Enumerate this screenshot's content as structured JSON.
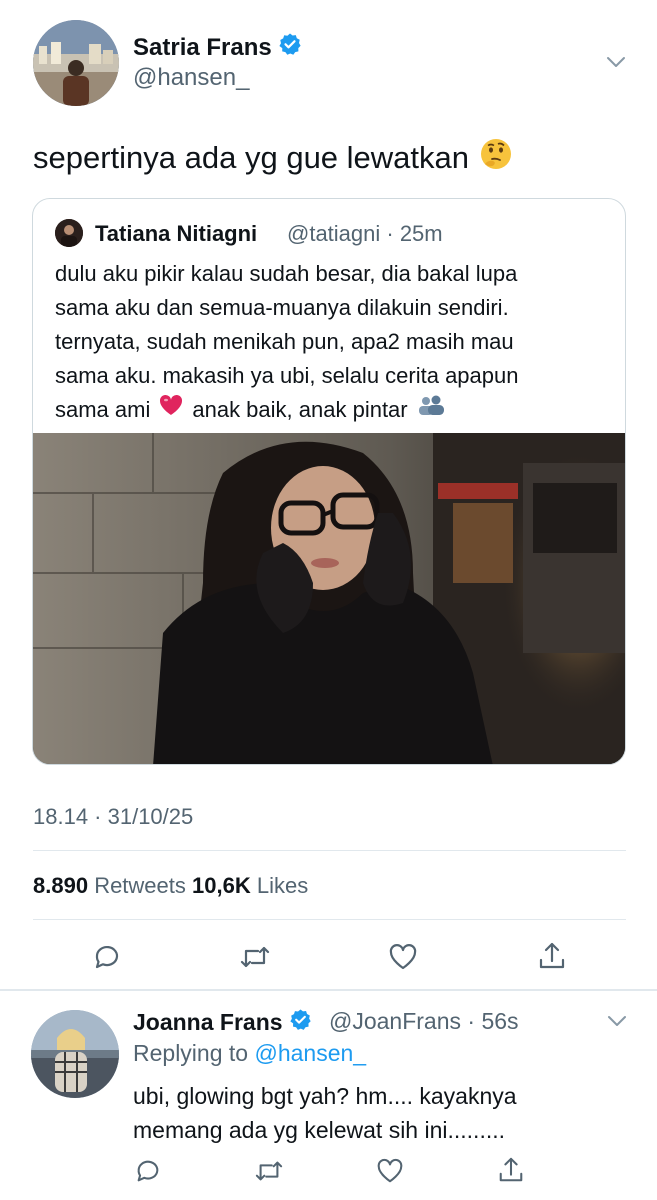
{
  "tweet": {
    "author_name": "Satria Frans",
    "author_handle": "@hansen_",
    "text": "sepertinya ada yg gue lewatkan",
    "emoji": "🤔",
    "verified": true,
    "quoted": {
      "author_name": "Tatiana Nitiagni",
      "meta": "@tatiagni · 25m",
      "lines": [
        "dulu aku pikir kalau sudah besar, dia bakal lupa",
        "sama aku dan semua-muanya dilakuin sendiri.",
        "ternyata, sudah menikah pun, apa2 masih mau",
        "sama aku. makasih ya ubi, selalu cerita apapun"
      ],
      "last_line_a": "sama ami",
      "heart_emoji": "❤️",
      "last_line_b": "anak baik, anak pintar",
      "people_emoji": "👥"
    },
    "timestamp": "18.14 · 31/10/25",
    "retweets_count": "8.890",
    "retweets_label": "Retweets",
    "likes_count": "10,6K",
    "likes_label": "Likes"
  },
  "reply": {
    "author_name": "Joanna Frans",
    "meta": "@JoanFrans · 56s",
    "replying_prefix": "Replying to",
    "replying_to": "@hansen_",
    "lines": [
      "ubi, glowing bgt yah? hm.... kayaknya",
      "memang ada yg kelewat sih ini........."
    ],
    "verified": true
  },
  "colors": {
    "accent": "#1d9bf0",
    "secondary_text": "#536471",
    "divider": "#e1e8ed",
    "heart": "#e0245e"
  }
}
